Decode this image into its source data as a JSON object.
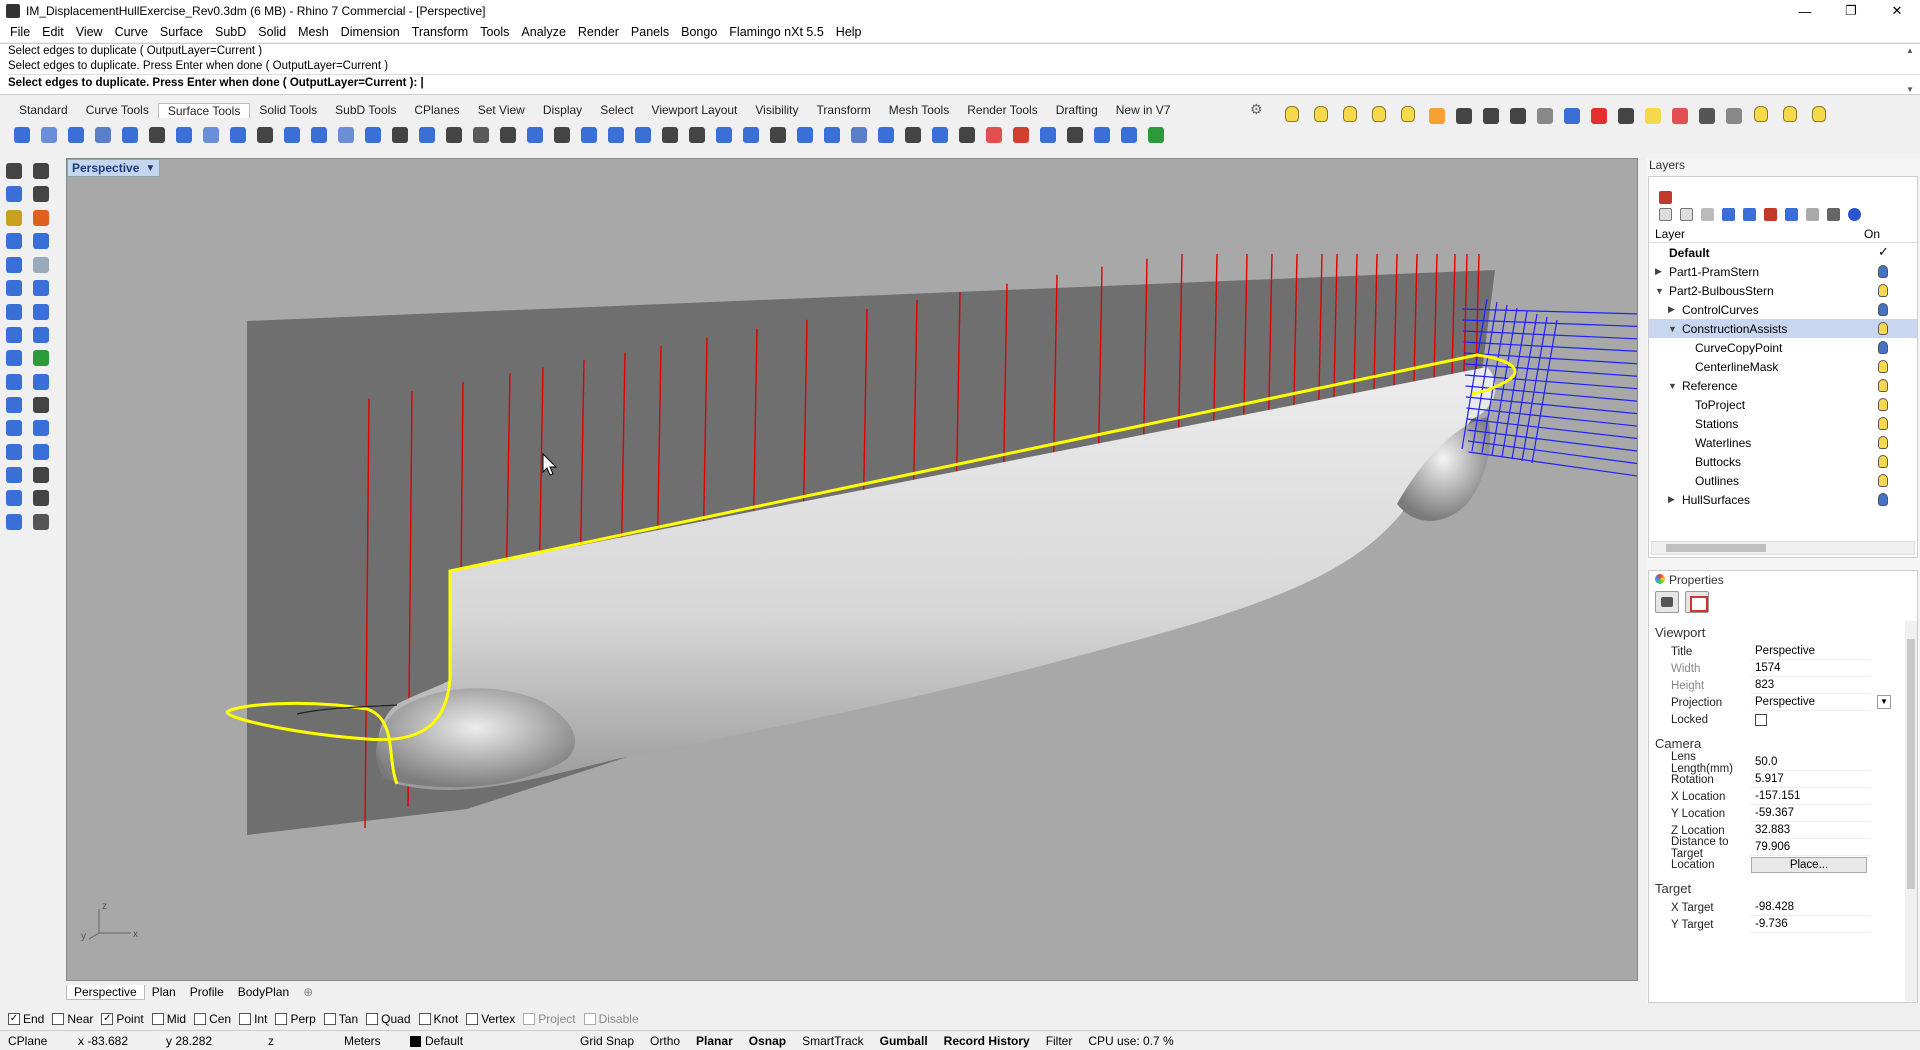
{
  "window": {
    "title": "IM_DisplacementHullExercise_Rev0.3dm (6 MB) - Rhino 7 Commercial - [Perspective]"
  },
  "menu": [
    "File",
    "Edit",
    "View",
    "Curve",
    "Surface",
    "SubD",
    "Solid",
    "Mesh",
    "Dimension",
    "Transform",
    "Tools",
    "Analyze",
    "Render",
    "Panels",
    "Bongo",
    "Flamingo nXt 5.5",
    "Help"
  ],
  "command": {
    "history": [
      "Select edges to duplicate ( OutputLayer=Current )",
      "Select edges to duplicate. Press Enter when done ( OutputLayer=Current )"
    ],
    "prompt": "Select edges to duplicate. Press Enter when done ( OutputLayer=Current ):"
  },
  "toolbar_tabs": [
    "Standard",
    "Curve Tools",
    "Surface Tools",
    "Solid Tools",
    "SubD Tools",
    "CPlanes",
    "Set View",
    "Display",
    "Select",
    "Viewport Layout",
    "Visibility",
    "Transform",
    "Mesh Tools",
    "Render Tools",
    "Drafting",
    "New in V7"
  ],
  "active_toolbar_tab": "Surface Tools",
  "viewport": {
    "name": "Perspective",
    "axis_x": "x",
    "axis_y": "y",
    "axis_z": "z"
  },
  "viewport_tabs": [
    "Perspective",
    "Plan",
    "Profile",
    "BodyPlan"
  ],
  "viewport_tab_add": "⊕",
  "osnaps": [
    {
      "label": "End",
      "checked": true
    },
    {
      "label": "Near",
      "checked": false
    },
    {
      "label": "Point",
      "checked": true
    },
    {
      "label": "Mid",
      "checked": false
    },
    {
      "label": "Cen",
      "checked": false
    },
    {
      "label": "Int",
      "checked": false
    },
    {
      "label": "Perp",
      "checked": false
    },
    {
      "label": "Tan",
      "checked": false
    },
    {
      "label": "Quad",
      "checked": false
    },
    {
      "label": "Knot",
      "checked": false
    },
    {
      "label": "Vertex",
      "checked": false
    },
    {
      "label": "Project",
      "checked": false,
      "disabled": true
    },
    {
      "label": "Disable",
      "checked": false,
      "disabled": true
    }
  ],
  "status": {
    "cplane": "CPlane",
    "x": "x -83.682",
    "y": "y 28.282",
    "z": "z",
    "units": "Meters",
    "layer": "Default",
    "grid_snap": "Grid Snap",
    "ortho": "Ortho",
    "planar": "Planar",
    "osnap": "Osnap",
    "smarttrack": "SmartTrack",
    "gumball": "Gumball",
    "record_history": "Record History",
    "filter": "Filter",
    "cpu": "CPU use: 0.7 %"
  },
  "layers": {
    "title": "Layers",
    "col_layer": "Layer",
    "col_on": "On",
    "rows": [
      {
        "name": "Default",
        "level": 0,
        "bold": true,
        "current": true,
        "check": "✓"
      },
      {
        "name": "Part1-PramStern",
        "level": 0,
        "twisty": "closed",
        "color": "#4472c4"
      },
      {
        "name": "Part2-BulbousStern",
        "level": 0,
        "twisty": "open",
        "color": "#f5d94a"
      },
      {
        "name": "ControlCurves",
        "level": 1,
        "twisty": "closed",
        "color": "#4472c4"
      },
      {
        "name": "ConstructionAssists",
        "level": 1,
        "twisty": "open",
        "color": "#f5d94a",
        "selected": true
      },
      {
        "name": "CurveCopyPoint",
        "level": 2,
        "color": "#4472c4"
      },
      {
        "name": "CenterlineMask",
        "level": 2,
        "color": "#f5d94a"
      },
      {
        "name": "Reference",
        "level": 1,
        "twisty": "open",
        "color": "#f5d94a"
      },
      {
        "name": "ToProject",
        "level": 2,
        "color": "#f5d94a"
      },
      {
        "name": "Stations",
        "level": 2,
        "color": "#f5d94a"
      },
      {
        "name": "Waterlines",
        "level": 2,
        "color": "#f5d94a"
      },
      {
        "name": "Buttocks",
        "level": 2,
        "color": "#f5d94a"
      },
      {
        "name": "Outlines",
        "level": 2,
        "color": "#f5d94a"
      },
      {
        "name": "HullSurfaces",
        "level": 1,
        "twisty": "closed",
        "color": "#4472c4"
      }
    ]
  },
  "properties": {
    "title": "Properties",
    "viewport_section": "Viewport",
    "viewport_fields": [
      {
        "k": "Title",
        "v": "Perspective"
      },
      {
        "k": "Width",
        "v": "1574",
        "dim": true
      },
      {
        "k": "Height",
        "v": "823",
        "dim": true
      },
      {
        "k": "Projection",
        "v": "Perspective",
        "dropdown": true
      },
      {
        "k": "Locked",
        "v": "",
        "checkbox": true
      }
    ],
    "camera_section": "Camera",
    "camera_fields": [
      {
        "k": "Lens Length(mm)",
        "v": "50.0"
      },
      {
        "k": "Rotation",
        "v": "5.917"
      },
      {
        "k": "X Location",
        "v": "-157.151"
      },
      {
        "k": "Y Location",
        "v": "-59.367"
      },
      {
        "k": "Z Location",
        "v": "32.883"
      },
      {
        "k": "Distance to Target",
        "v": "79.906"
      },
      {
        "k": "Location",
        "v": "Place...",
        "button": true
      }
    ],
    "target_section": "Target",
    "target_fields": [
      {
        "k": "X Target",
        "v": "-98.428"
      },
      {
        "k": "Y Target",
        "v": "-9.736"
      }
    ]
  },
  "colors": {
    "viewport_bg": "#a8a8a8",
    "hull_edge": "#ffff00",
    "station_lines": "#e00000",
    "grid_lines": "#2020ff",
    "selection": "#c9d6ef"
  }
}
